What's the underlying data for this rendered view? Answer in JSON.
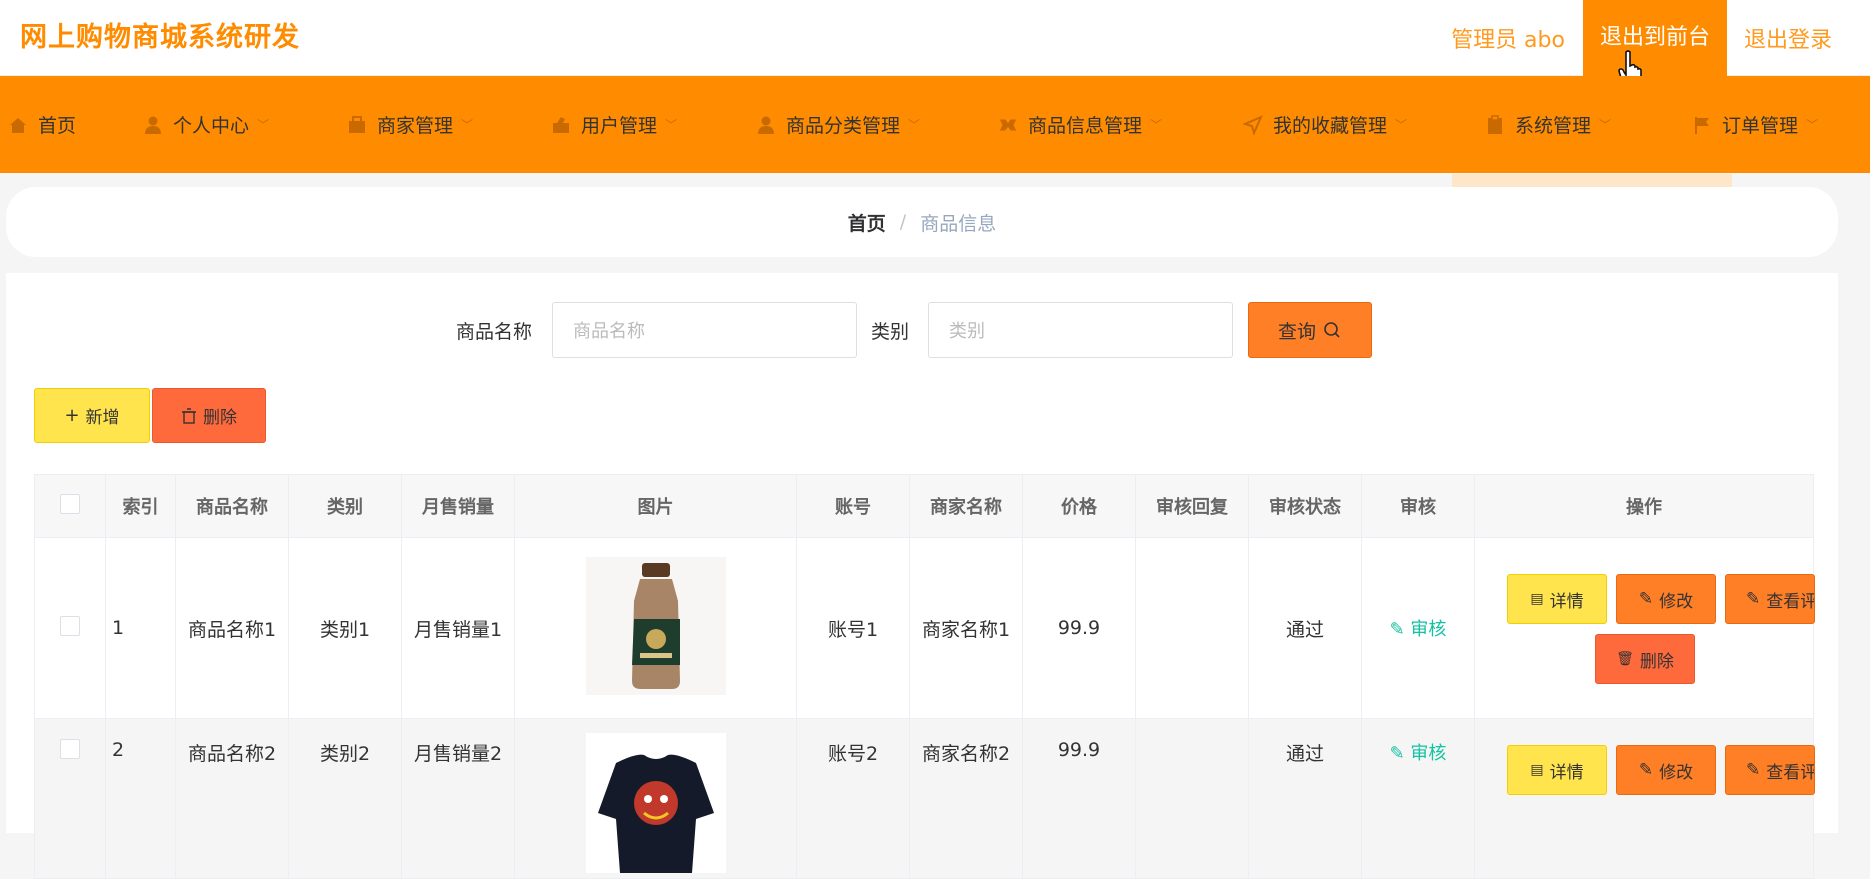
{
  "header": {
    "title": "网上购物商城系统研发",
    "admin_label": "管理员 abo",
    "front_label": "退出到前台",
    "logout_label": "退出登录",
    "accent": "#ff8c00"
  },
  "nav": {
    "items": [
      {
        "label": "首页",
        "icon": "home-icon"
      },
      {
        "label": "个人中心",
        "icon": "user-icon"
      },
      {
        "label": "商家管理",
        "icon": "shop-icon"
      },
      {
        "label": "用户管理",
        "icon": "user-manage-icon"
      },
      {
        "label": "商品分类管理",
        "icon": "category-icon"
      },
      {
        "label": "商品信息管理",
        "icon": "goods-icon"
      },
      {
        "label": "我的收藏管理",
        "icon": "send-icon"
      },
      {
        "label": "系统管理",
        "icon": "clipboard-icon"
      },
      {
        "label": "订单管理",
        "icon": "flag-icon"
      }
    ],
    "active": "商品信息管理"
  },
  "breadcrumb": {
    "home": "首页",
    "current": "商品信息"
  },
  "search": {
    "name_label": "商品名称",
    "name_placeholder": "商品名称",
    "cat_label": "类别",
    "cat_placeholder": "类别",
    "query_label": "查询"
  },
  "actions": {
    "add_label": "新增",
    "delete_label": "删除"
  },
  "table": {
    "columns": [
      "索引",
      "商品名称",
      "类别",
      "月售销量",
      "图片",
      "账号",
      "商家名称",
      "价格",
      "审核回复",
      "审核状态",
      "审核",
      "操作"
    ],
    "rows": [
      {
        "index": "1",
        "name": "商品名称1",
        "category": "类别1",
        "sales": "月售销量1",
        "account": "账号1",
        "merchant": "商家名称1",
        "price": "99.9",
        "reply": "",
        "status": "通过",
        "audit": "审核"
      },
      {
        "index": "2",
        "name": "商品名称2",
        "category": "类别2",
        "sales": "月售销量2",
        "account": "账号2",
        "merchant": "商家名称2",
        "price": "99.9",
        "reply": "",
        "status": "通过",
        "audit": "审核"
      }
    ],
    "op_detail": "详情",
    "op_edit": "修改",
    "op_view": "查看评",
    "op_delete": "删除"
  }
}
